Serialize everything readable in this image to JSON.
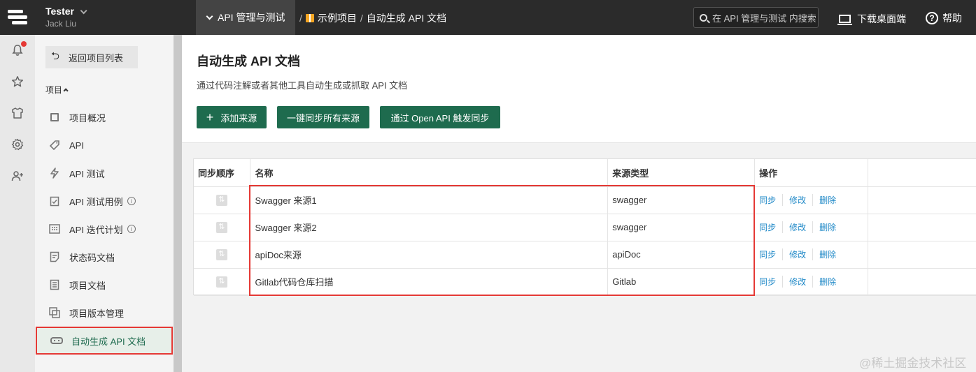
{
  "header": {
    "user_name": "Tester",
    "user_sub": "Jack Liu",
    "project_switch": "API 管理与测试",
    "breadcrumbs": [
      "示例项目",
      "自动生成 API 文档"
    ],
    "search_placeholder": "在 API 管理与测试 内搜索",
    "download_label": "下载桌面端",
    "help_label": "帮助",
    "help_glyph": "?"
  },
  "rail": {
    "icons": [
      "bell-icon",
      "star-icon",
      "shirt-icon",
      "settings-icon",
      "add-user-icon"
    ]
  },
  "sidebar": {
    "back_label": "返回项目列表",
    "section_label": "项目",
    "items": [
      {
        "label": "项目概况",
        "icon": "overview-icon"
      },
      {
        "label": "API",
        "icon": "tag-icon"
      },
      {
        "label": "API 测试",
        "icon": "lightning-icon"
      },
      {
        "label": "API 测试用例",
        "icon": "clipboard-check-icon"
      },
      {
        "label": "API 迭代计划",
        "icon": "calendar-icon"
      },
      {
        "label": "状态码文档",
        "icon": "document-icon"
      },
      {
        "label": "项目文档",
        "icon": "list-doc-icon"
      },
      {
        "label": "项目版本管理",
        "icon": "versions-icon"
      },
      {
        "label": "自动生成 API 文档",
        "icon": "robot-icon"
      }
    ],
    "info_glyph": "i"
  },
  "main": {
    "title": "自动生成 API 文档",
    "description": "通过代码注解或者其他工具自动生成或抓取 API 文档",
    "buttons": {
      "add_source": "添加来源",
      "sync_all": "一键同步所有来源",
      "openapi_sync": "通过 Open API 触发同步"
    },
    "table": {
      "headers": [
        "同步顺序",
        "名称",
        "来源类型",
        "操作"
      ],
      "rows": [
        {
          "name": "Swagger 来源1",
          "type": "swagger"
        },
        {
          "name": "Swagger 来源2",
          "type": "swagger"
        },
        {
          "name": "apiDoc来源",
          "type": "apiDoc"
        },
        {
          "name": "Gitlab代码仓库扫描",
          "type": "Gitlab"
        }
      ],
      "actions": [
        "同步",
        "修改",
        "删除"
      ]
    }
  },
  "watermark": "@稀土掘金技术社区",
  "colors": {
    "accent": "#1e6b4e",
    "link": "#1e88c7",
    "highlight": "#e53935"
  }
}
